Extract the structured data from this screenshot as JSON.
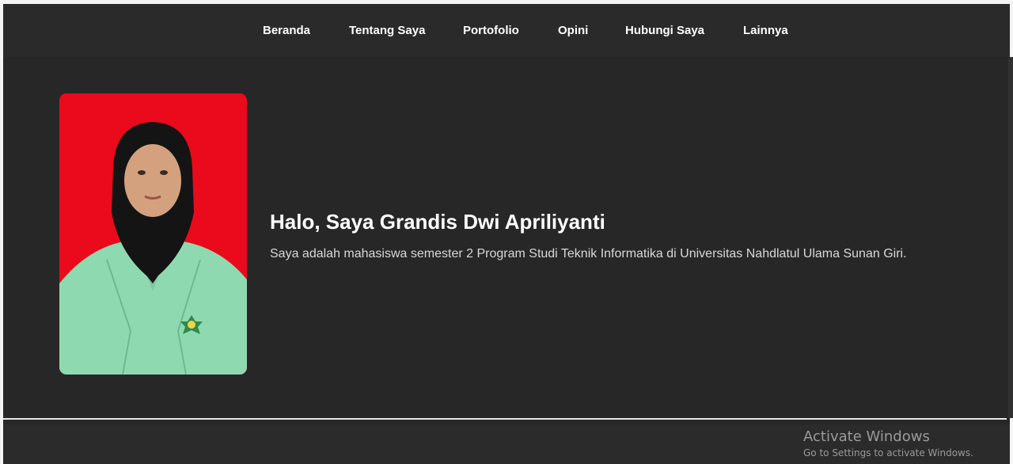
{
  "nav": {
    "items": [
      {
        "label": "Beranda"
      },
      {
        "label": "Tentang Saya"
      },
      {
        "label": "Portofolio"
      },
      {
        "label": "Opini"
      },
      {
        "label": "Hubungi Saya"
      },
      {
        "label": "Lainnya"
      }
    ]
  },
  "hero": {
    "title": "Halo, Saya Grandis Dwi Apriliyanti",
    "description": "Saya adalah mahasiswa semester 2 Program Studi Teknik Informatika di Universitas Nahdlatul Ulama Sunan Giri.",
    "photo_background": "#ea0a1b",
    "jacket_color": "#8fd9b0",
    "hijab_color": "#111111"
  },
  "watermark": {
    "title": "Activate Windows",
    "subtitle": "Go to Settings to activate Windows."
  },
  "colors": {
    "page_bg": "#272727",
    "nav_bg": "#2a2a2a",
    "text": "#ffffff"
  }
}
